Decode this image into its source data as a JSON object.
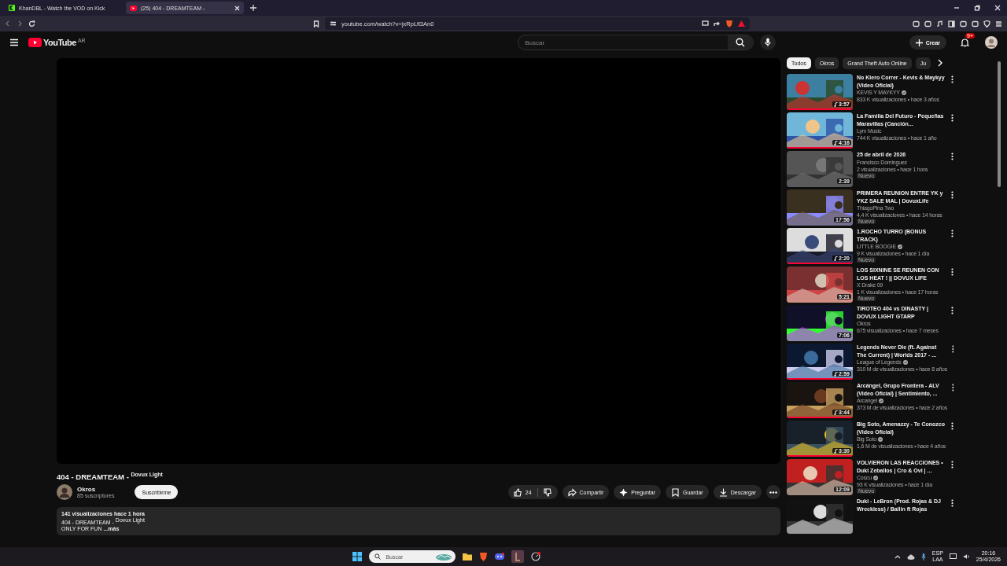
{
  "browser": {
    "tabs": [
      {
        "title": "KhanDBL - Watch the VOD on Kick",
        "selected": false,
        "kind": "kick"
      },
      {
        "title": "(25) 404 - DREAMTEAM -",
        "selected": true,
        "kind": "youtube"
      }
    ],
    "url": "youtube.com/watch?v=jxRpLfl3An0"
  },
  "header": {
    "logo": "YouTube",
    "country": "AR",
    "search_placeholder": "Buscar",
    "create": "Crear",
    "notifications": "9+"
  },
  "video": {
    "title": "404 - DREAMTEAM - $^{Dovux Light}$",
    "channel": "Okros",
    "subscribers": "85 suscriptores",
    "subscribe": "Suscribirme",
    "likes": "24",
    "actions": [
      {
        "kind": "share",
        "label": "Compartir"
      },
      {
        "kind": "ask",
        "label": "Preguntar"
      },
      {
        "kind": "save",
        "label": "Guardar"
      },
      {
        "kind": "download",
        "label": "Descargar"
      }
    ]
  },
  "description": {
    "stats": "141 visualizaciones  hace 1 hora",
    "lines": [
      "404 - DREAMTEAM - $^{Dovux Light}$"
    ],
    "text": "ONLY FOR FUN",
    "more": "...más"
  },
  "chips": [
    {
      "label": "Todos",
      "selected": true
    },
    {
      "label": "Okros",
      "selected": false
    },
    {
      "label": "Grand Theft Auto Online",
      "selected": false
    },
    {
      "label": "Ju",
      "selected": false
    }
  ],
  "recommendations": [
    {
      "title": "No Kiero Correr - Kevis & Maykyy (Video Oficial)",
      "channel": "KEVIS Y MAYKYY",
      "verified": true,
      "stats": "833 K visualizaciones • hace 3 años",
      "duration": "3:57",
      "music": true,
      "level": 1
    },
    {
      "title": "La Familia Del Futuro - Pequeñas Maravillas (Canción...",
      "channel": "Lyrx Music",
      "verified": false,
      "stats": "744 K visualizaciones • hace 1 año",
      "duration": "4:16",
      "music": true,
      "level": 1
    },
    {
      "title": "25 de abril de 2026",
      "channel": "Francisco Dominguez",
      "verified": false,
      "stats": "2 visualizaciones • hace 1 hora",
      "badge": "Nuevo",
      "duration": "2:39",
      "music": false
    },
    {
      "title": "PRIMERA REUNION ENTRE YK y YKZ SALE MAL | DovuxLife",
      "channel": "ThiagoPina Two",
      "verified": false,
      "stats": "4,4 K visualizaciones • hace 14 horas",
      "badge": "Nuevo",
      "duration": "17:56",
      "music": false
    },
    {
      "title": "1.ROCHO TURRO (BONUS TRACK)",
      "channel": "LITTLE BOOGIE",
      "verified": true,
      "stats": "9 K visualizaciones • hace 1 día",
      "badge": "Nuevo",
      "duration": "2:20",
      "music": true,
      "level": 1
    },
    {
      "title": "LOS SIXNINE SE REUNEN CON LOS HEAT ! ||  DOVUX LIFE",
      "channel": "X Drake 09",
      "verified": false,
      "stats": "1 K visualizaciones • hace 17 horas",
      "badge": "Nuevo",
      "duration": "5:21",
      "music": false
    },
    {
      "title": "TIROTEO 404 vs DINASTY | DOVUX LIGHT GTARP",
      "channel": "Okros",
      "verified": false,
      "stats": "675 visualizaciones • hace 7 meses",
      "duration": "7:06",
      "music": false
    },
    {
      "title": "Legends Never Die (ft. Against The Current) | Worlds 2017 - ...",
      "channel": "League of Legends",
      "verified": true,
      "stats": "310 M de visualizaciones • hace 8 años",
      "duration": "2:59",
      "music": true,
      "level": 1
    },
    {
      "title": "Arcángel, Grupo Frontera - ALV (Video Oficial) | Sentimiento, ...",
      "channel": "Arcangel",
      "verified": true,
      "stats": "373 M de visualizaciones • hace 2 años",
      "duration": "3:44",
      "music": true,
      "level": 1
    },
    {
      "title": "Big Soto, Amenazzy - Te Conozco (Video Oficial)",
      "channel": "Big Soto",
      "verified": true,
      "stats": "1,6 M de visualizaciones • hace 4 años",
      "duration": "3:30",
      "music": true,
      "level": 1
    },
    {
      "title": "VOLVIERON LAS REACCIONES • Duki Zeballos | Cro & Ovi | ...",
      "channel": "Coscu",
      "verified": true,
      "stats": "93 K visualizaciones • hace 1 día",
      "badge": "Nuevo",
      "duration": "12:09",
      "music": false
    },
    {
      "title": "Duki - LeBron (Prod. Rojas & DJ Wreckless) / Ballin ft Rojas",
      "music": false
    }
  ],
  "taskbar": {
    "search_placeholder": "Buscar",
    "language": "ESP",
    "layout": "LAA",
    "time": "20:16",
    "date": "25/4/2026"
  }
}
